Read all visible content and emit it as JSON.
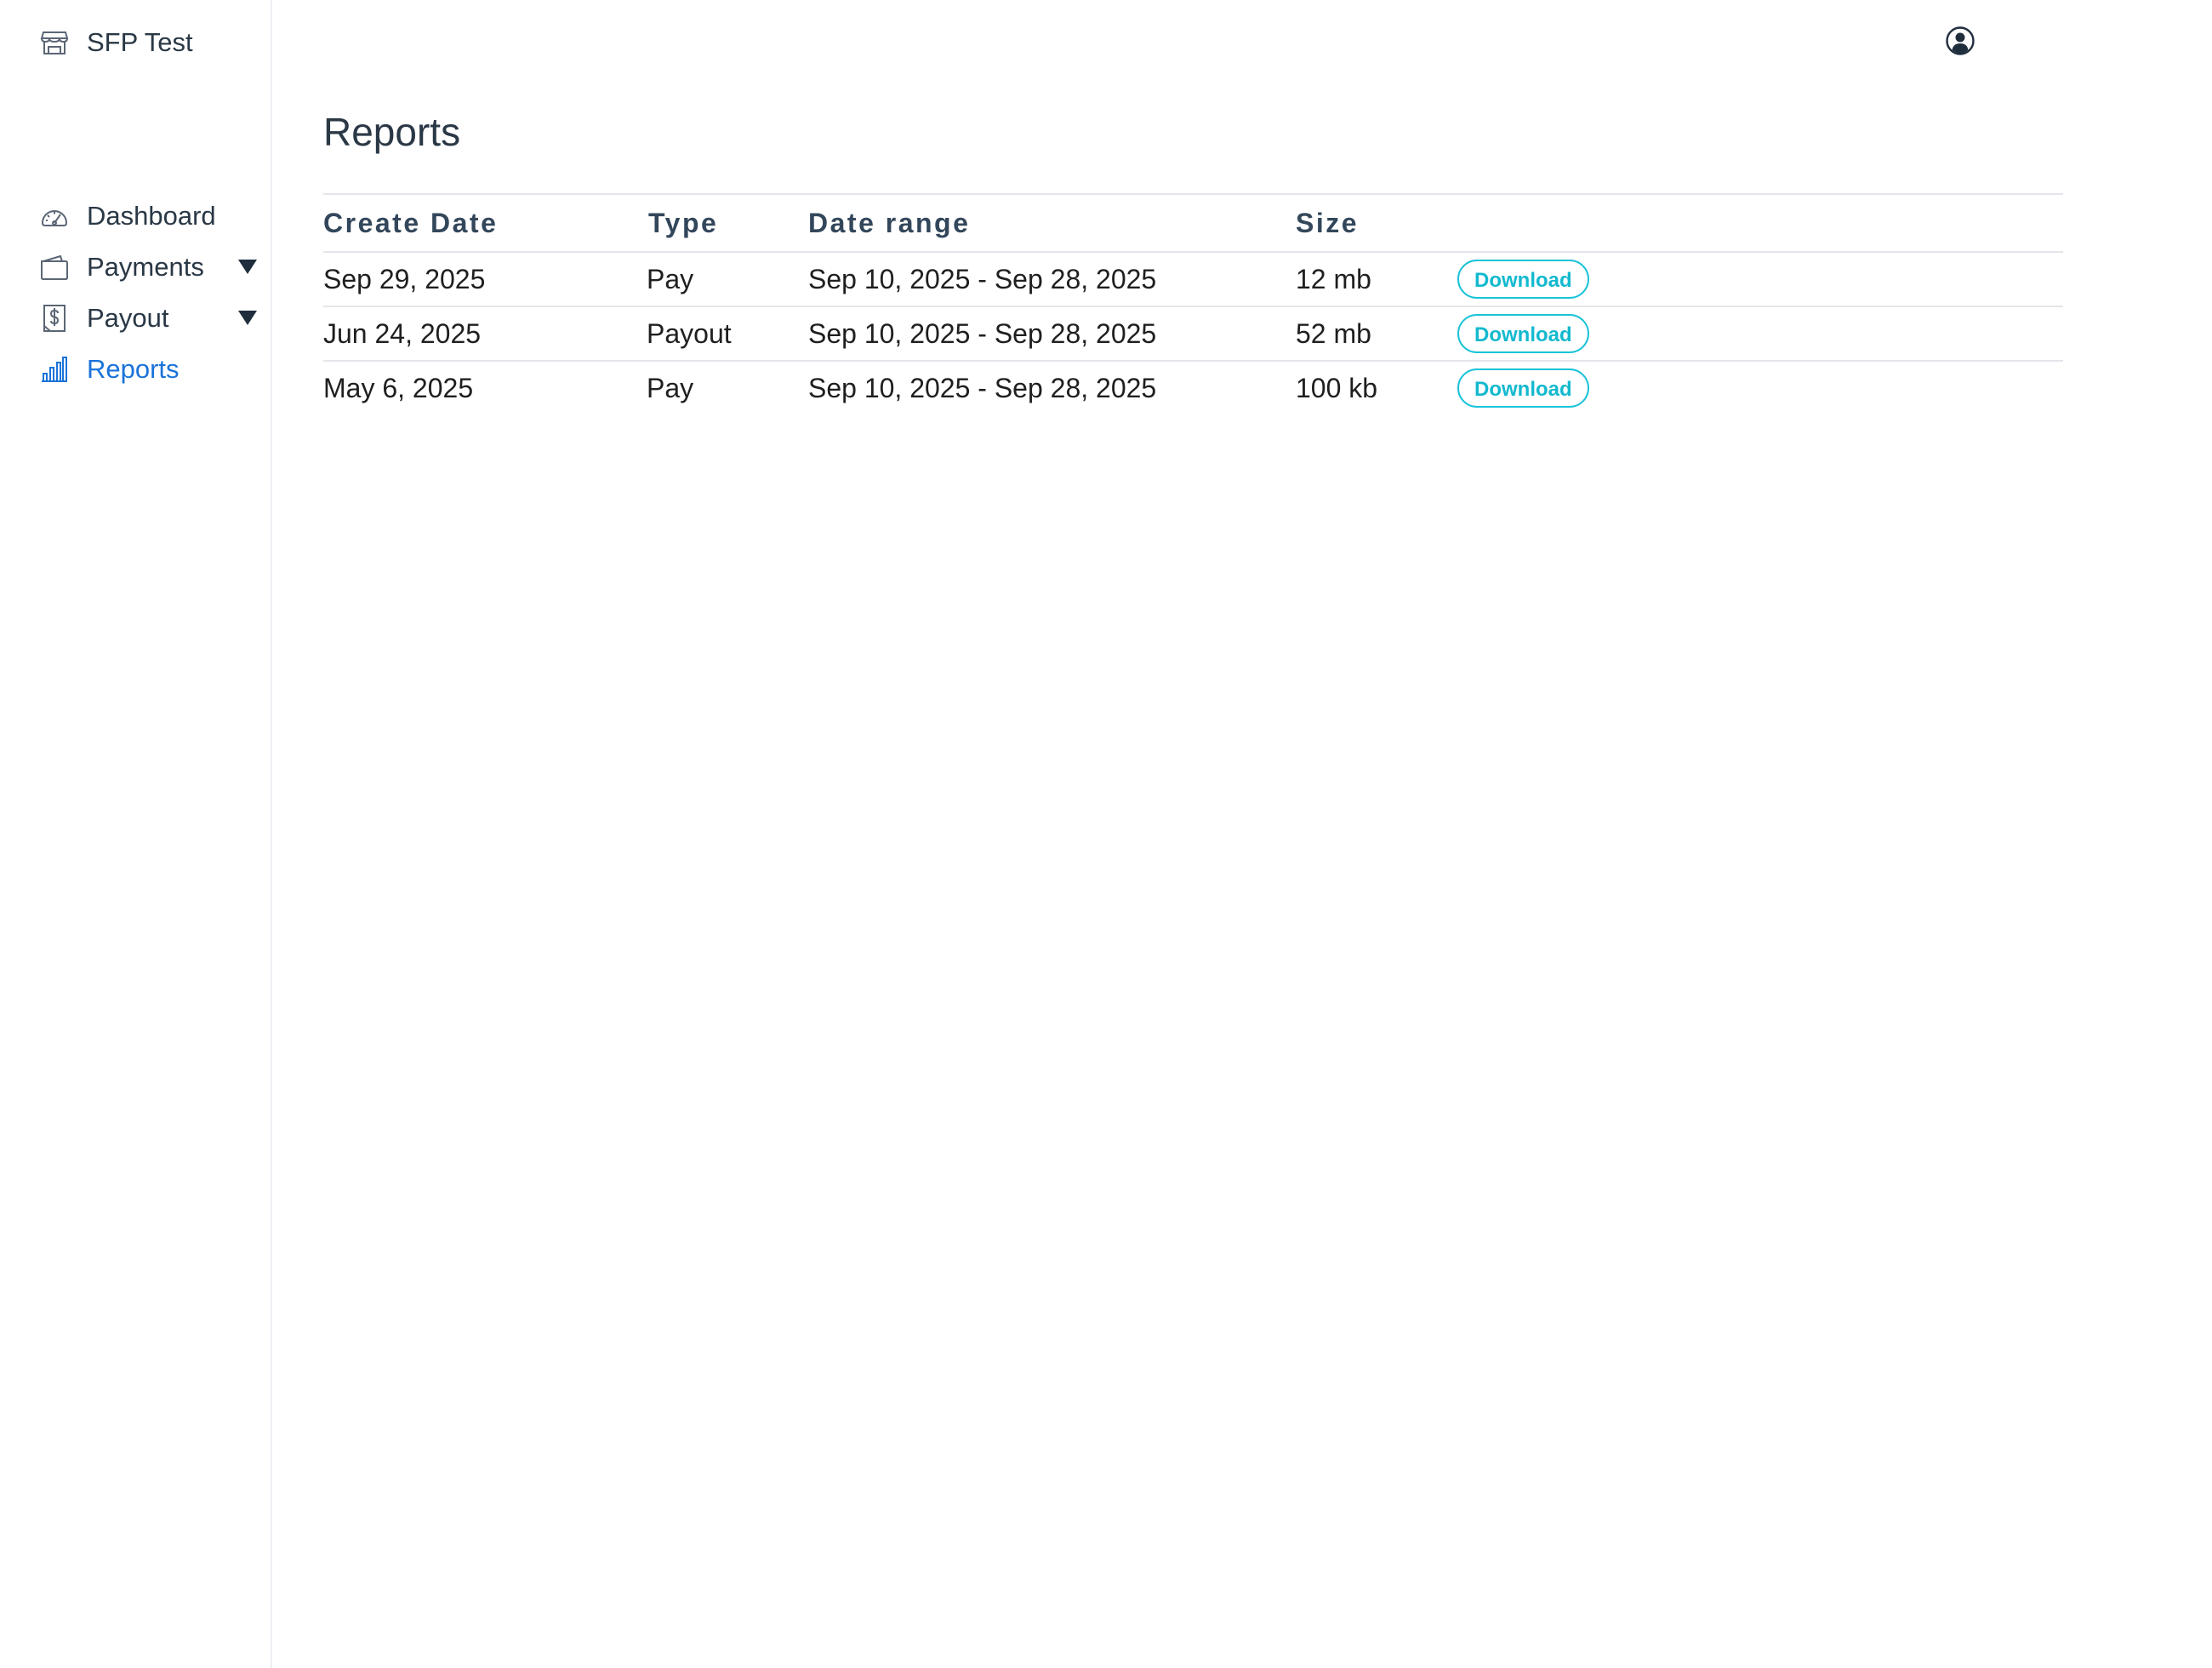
{
  "brand": {
    "name": "SFP Test",
    "icon": "store-icon"
  },
  "header": {
    "user_icon": "user-circle-icon"
  },
  "sidebar": {
    "items": [
      {
        "label": "Dashboard",
        "icon": "gauge-icon",
        "expandable": false,
        "active": false
      },
      {
        "label": "Payments",
        "icon": "wallet-icon",
        "expandable": true,
        "active": false
      },
      {
        "label": "Payout",
        "icon": "dollar-doc-icon",
        "expandable": true,
        "active": false
      },
      {
        "label": "Reports",
        "icon": "bar-chart-icon",
        "expandable": false,
        "active": true
      }
    ]
  },
  "main": {
    "title": "Reports",
    "table": {
      "columns": [
        "Create Date",
        "Type",
        "Date range",
        "Size",
        ""
      ],
      "rows": [
        {
          "create_date": "Sep 29, 2025",
          "type": "Pay",
          "date_range": "Sep 10, 2025 - Sep 28, 2025",
          "size": "12 mb",
          "action": "Download"
        },
        {
          "create_date": "Jun 24, 2025",
          "type": "Payout",
          "date_range": "Sep 10, 2025 - Sep 28, 2025",
          "size": "52 mb",
          "action": "Download"
        },
        {
          "create_date": "May 6, 2025",
          "type": "Pay",
          "date_range": "Sep 10, 2025 - Sep 28, 2025",
          "size": "100 kb",
          "action": "Download"
        }
      ]
    }
  },
  "colors": {
    "accent": "#1a73d9",
    "button_border": "#19c3d8",
    "text": "#1f2d3d",
    "divider": "#e3e6ea"
  }
}
